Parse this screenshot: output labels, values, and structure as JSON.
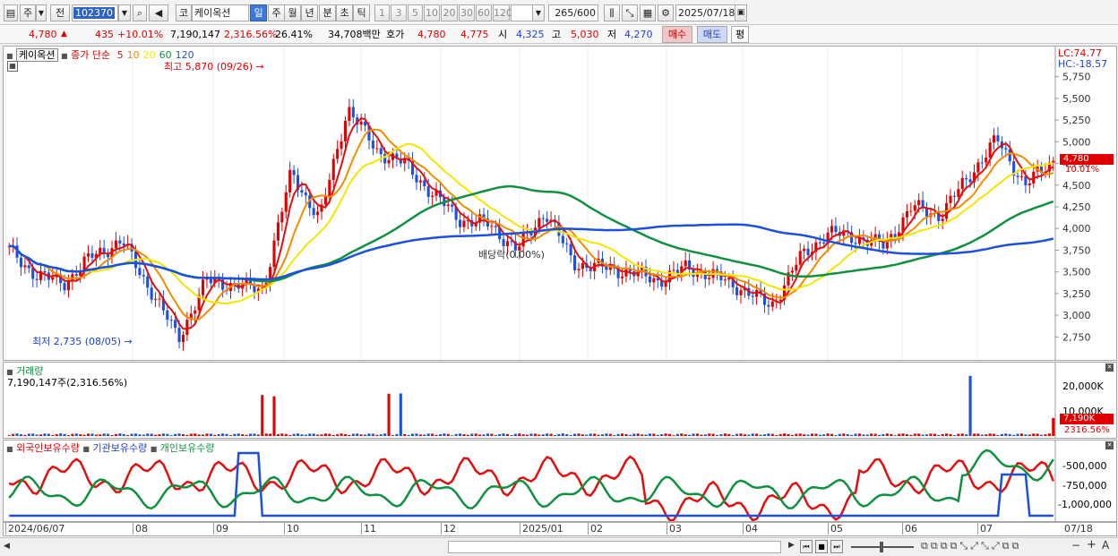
{
  "toolbar": {
    "period_label": "주",
    "prev_label": "전",
    "code_value": "102370",
    "market_label": "코",
    "stock_name": "케이옥션",
    "timeframes": [
      "일",
      "주",
      "월",
      "년",
      "분",
      "초",
      "틱"
    ],
    "selected_timeframe": "일",
    "intervals": [
      "1",
      "3",
      "5",
      "10",
      "20",
      "30",
      "60",
      "120"
    ],
    "count": "265",
    "count_total": "/600",
    "date": "2025/07/18"
  },
  "quote": {
    "price": "4,780",
    "change": "435",
    "change_rate": "+10.01%",
    "volume": "7,190,147",
    "volume_rate": "2,316.56%",
    "turnover": "26.41%",
    "amount": "34,708백만",
    "bid_label": "호가",
    "bid": "4,780",
    "ask": "4,775",
    "open_label": "시",
    "open": "4,325",
    "high_label": "고",
    "high": "5,030",
    "low_label": "저",
    "low": "4,270",
    "buy_button": "매수",
    "sell_button": "매도",
    "eval_button": "평"
  },
  "price_pane": {
    "name_tag": "케이옥션",
    "legend_label": "종가 단순",
    "ma_periods": [
      "5",
      "10",
      "20",
      "60",
      "120"
    ],
    "ma_colors": [
      "#e01010",
      "#f08c00",
      "#f5e600",
      "#109040",
      "#1e50e0"
    ],
    "max_label": "최고 5,870 (09/26)",
    "min_label": "최저 2,735 (08/05)",
    "ex_div_label": "배당락(0.00%)",
    "lc_label": "LC:74.77",
    "hc_label": "HC:-18.57",
    "current_price_tag": "4,780",
    "current_change_tag": "10.01%",
    "y_ticks": [
      "5,750",
      "5,500",
      "5,250",
      "5,000",
      "4,750",
      "4,500",
      "4,250",
      "4,000",
      "3,750",
      "3,500",
      "3,250",
      "3,000",
      "2,750"
    ]
  },
  "volume_pane": {
    "title": "거래량",
    "value_label": "7,190,147주(2,316.56%)",
    "y_ticks": [
      "20,000K",
      "10,000K"
    ],
    "current_tag": "7,190K",
    "current_rate_tag": "2316.56%"
  },
  "holding_pane": {
    "series_labels": [
      "외국인보유수량",
      "기관보유수량",
      "개인보유수량"
    ],
    "series_colors": [
      "#e01010",
      "#1e50e0",
      "#109040"
    ],
    "y_ticks": [
      "-500,000",
      "-750,000",
      "-1,000,000"
    ]
  },
  "x_axis": {
    "labels": [
      "2024/06/07",
      "08",
      "09",
      "10",
      "11",
      "12",
      "2025/01",
      "02",
      "03",
      "04",
      "05",
      "06",
      "07"
    ],
    "end_label": "07/18"
  },
  "chart_data": {
    "type": "candlestick",
    "price_range": [
      2650,
      5850
    ],
    "closes_approx": [
      3750,
      3450,
      3380,
      3700,
      3850,
      3300,
      2735,
      3400,
      3350,
      3300,
      4650,
      4100,
      5400,
      4900,
      4750,
      4400,
      4100,
      4050,
      3750,
      4200,
      3600,
      3550,
      3500,
      3400,
      3550,
      3450,
      3300,
      3100,
      3650,
      3950,
      3900,
      3800,
      4250,
      4150,
      4600,
      5030,
      4500,
      4780
    ],
    "volume_max_k": 25000,
    "last_volume_k": 7190
  }
}
